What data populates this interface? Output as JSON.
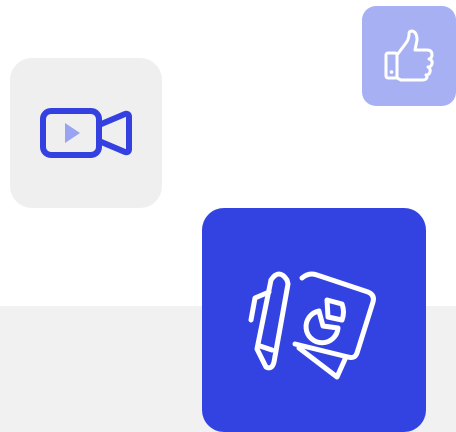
{
  "colors": {
    "band": "#f1f1f1",
    "video_tile_bg": "#efefef",
    "video_icon": "#3440e0",
    "like_tile_bg": "#a8b0f4",
    "like_icon": "#ffffff",
    "report_tile_bg": "#3343e2",
    "report_icon": "#ffffff"
  },
  "tiles": [
    {
      "name": "video-tile",
      "icon": "video-camera-icon"
    },
    {
      "name": "like-tile",
      "icon": "thumbs-up-icon"
    },
    {
      "name": "report-tile",
      "icon": "notebook-pie-chart-icon"
    }
  ]
}
